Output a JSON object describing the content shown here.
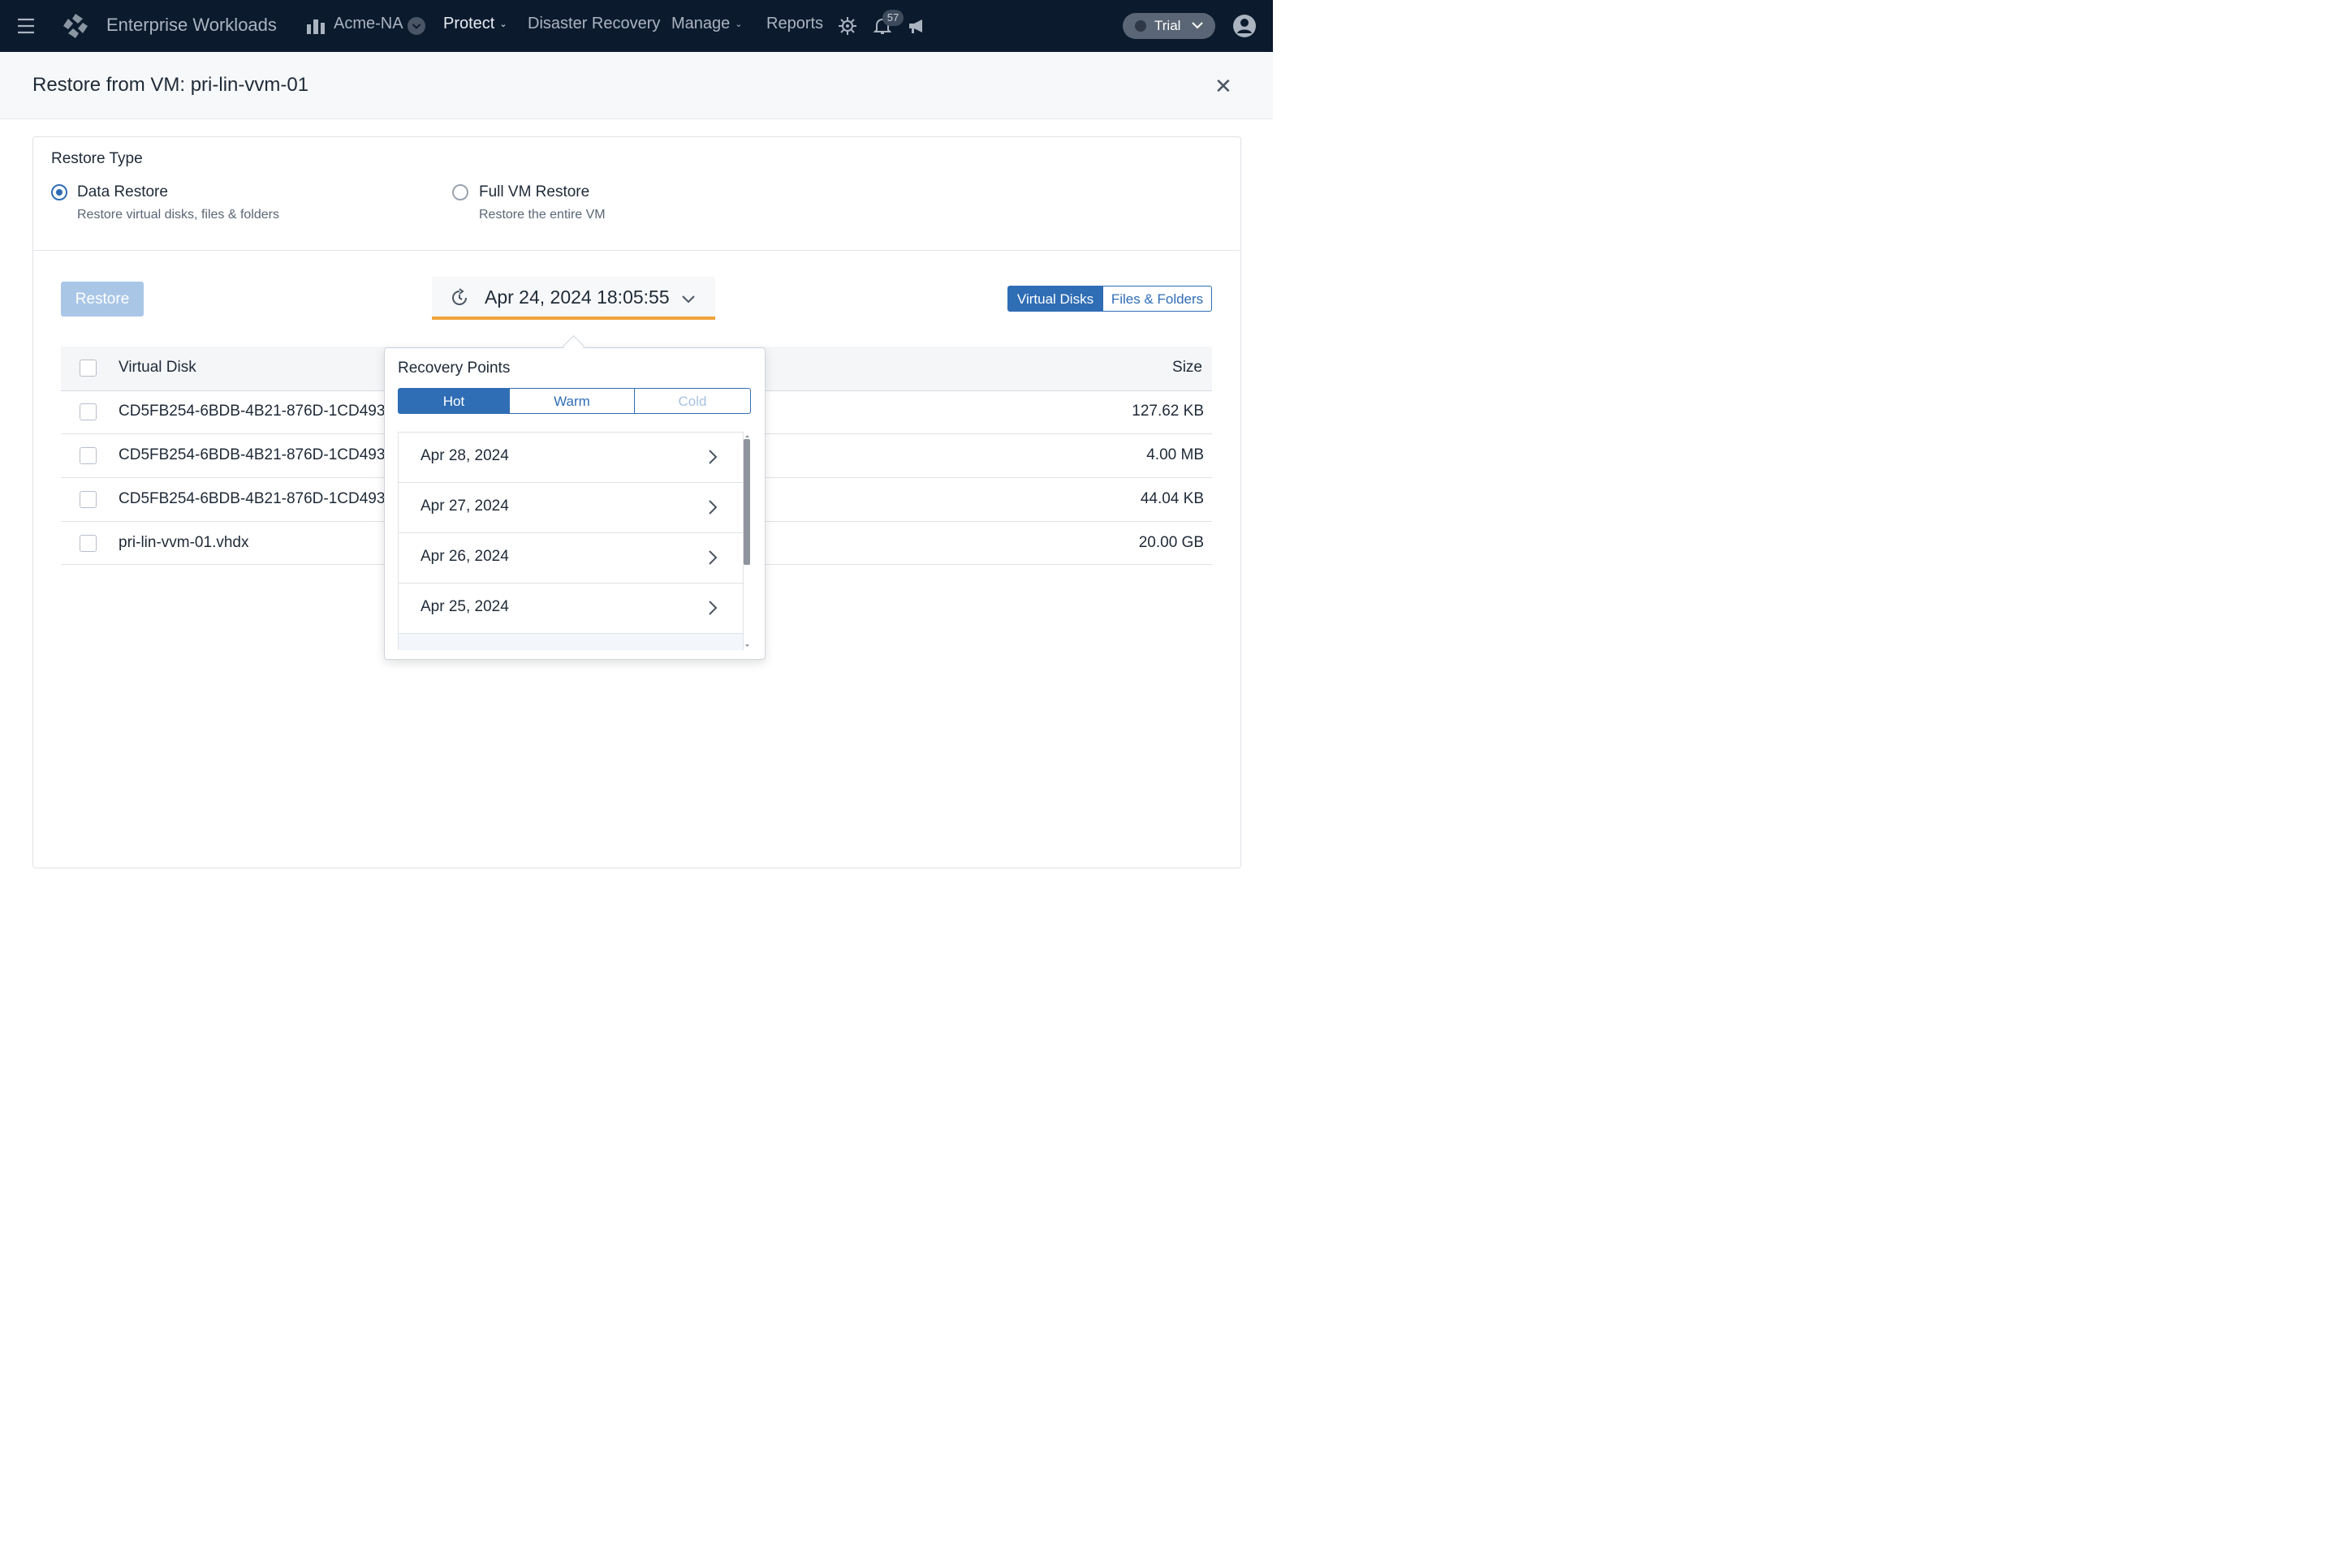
{
  "nav": {
    "app_title": "Enterprise Workloads",
    "org": "Acme-NA",
    "protect": "Protect",
    "disaster_recovery": "Disaster Recovery",
    "manage": "Manage",
    "reports": "Reports",
    "notification_count": "57",
    "trial": "Trial",
    "icons": [
      "menu-icon",
      "logo-icon",
      "building-icon",
      "chevron-down-icon",
      "gear-icon",
      "bell-icon",
      "megaphone-icon",
      "user-icon"
    ]
  },
  "dialog": {
    "title": "Restore from VM: pri-lin-vvm-01"
  },
  "restore_type": {
    "heading": "Restore Type",
    "options": [
      {
        "label": "Data Restore",
        "description": "Restore virtual disks, files & folders",
        "selected": true
      },
      {
        "label": "Full VM Restore",
        "description": "Restore the entire VM",
        "selected": false
      }
    ]
  },
  "toolbar": {
    "restore_label": "Restore",
    "selected_recovery_point": "Apr 24, 2024 18:05:55",
    "view_tabs": [
      "Virtual Disks",
      "Files & Folders"
    ],
    "active_view": "Virtual Disks"
  },
  "table": {
    "columns": [
      "Virtual Disk",
      "Size"
    ],
    "rows": [
      {
        "name": "CD5FB254-6BDB-4B21-876D-1CD4931",
        "size": "127.62 KB"
      },
      {
        "name": "CD5FB254-6BDB-4B21-876D-1CD4931",
        "size": "4.00 MB"
      },
      {
        "name": "CD5FB254-6BDB-4B21-876D-1CD4931",
        "size": "44.04 KB"
      },
      {
        "name": "pri-lin-vvm-01.vhdx",
        "size": "20.00 GB"
      }
    ]
  },
  "recovery_points": {
    "heading": "Recovery Points",
    "tiers": [
      "Hot",
      "Warm",
      "Cold"
    ],
    "active_tier": "Hot",
    "dates": [
      "Apr 28, 2024",
      "Apr 27, 2024",
      "Apr 26, 2024",
      "Apr 25, 2024"
    ]
  },
  "colors": {
    "nav_bg": "#0c1a2e",
    "accent": "#2f6db5",
    "date_underline": "#f2a33a",
    "restore_disabled": "#a9c6e6"
  }
}
